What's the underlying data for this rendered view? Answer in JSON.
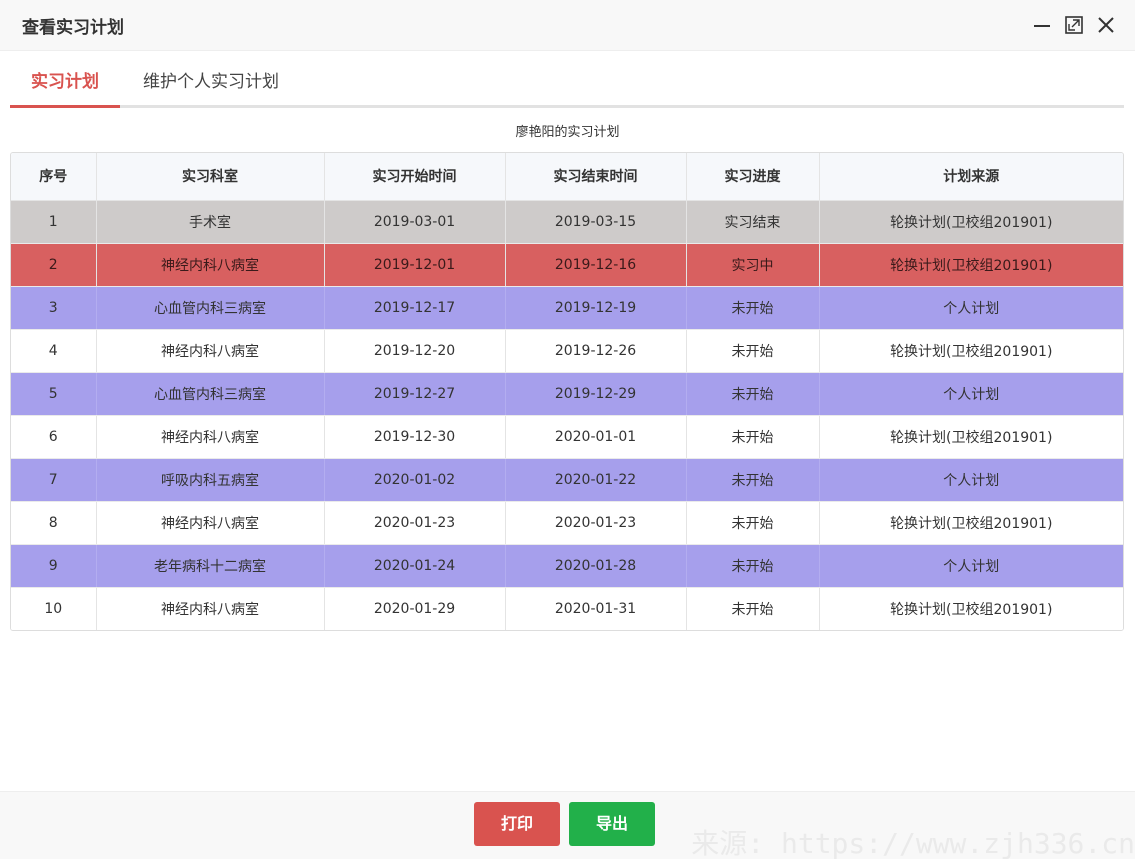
{
  "window": {
    "title": "查看实习计划",
    "controls": [
      "minimize-icon",
      "maximize-icon",
      "close-icon"
    ]
  },
  "tabs": [
    {
      "label": "实习计划",
      "active": true
    },
    {
      "label": "维护个人实习计划",
      "active": false
    }
  ],
  "table": {
    "caption": "廖艳阳的实习计划",
    "columns": [
      "序号",
      "实习科室",
      "实习开始时间",
      "实习结束时间",
      "实习进度",
      "计划来源"
    ],
    "rows": [
      {
        "no": "1",
        "dept": "手术室",
        "start": "2019-03-01",
        "end": "2019-03-15",
        "progress": "实习结束",
        "source": "轮换计划(卫校组201901)",
        "status": "done"
      },
      {
        "no": "2",
        "dept": "神经内科八病室",
        "start": "2019-12-01",
        "end": "2019-12-16",
        "progress": "实习中",
        "source": "轮换计划(卫校组201901)",
        "status": "doing"
      },
      {
        "no": "3",
        "dept": "心血管内科三病室",
        "start": "2019-12-17",
        "end": "2019-12-19",
        "progress": "未开始",
        "source": "个人计划",
        "status": "personal"
      },
      {
        "no": "4",
        "dept": "神经内科八病室",
        "start": "2019-12-20",
        "end": "2019-12-26",
        "progress": "未开始",
        "source": "轮换计划(卫校组201901)",
        "status": "normal"
      },
      {
        "no": "5",
        "dept": "心血管内科三病室",
        "start": "2019-12-27",
        "end": "2019-12-29",
        "progress": "未开始",
        "source": "个人计划",
        "status": "personal"
      },
      {
        "no": "6",
        "dept": "神经内科八病室",
        "start": "2019-12-30",
        "end": "2020-01-01",
        "progress": "未开始",
        "source": "轮换计划(卫校组201901)",
        "status": "normal"
      },
      {
        "no": "7",
        "dept": "呼吸内科五病室",
        "start": "2020-01-02",
        "end": "2020-01-22",
        "progress": "未开始",
        "source": "个人计划",
        "status": "personal"
      },
      {
        "no": "8",
        "dept": "神经内科八病室",
        "start": "2020-01-23",
        "end": "2020-01-23",
        "progress": "未开始",
        "source": "轮换计划(卫校组201901)",
        "status": "normal"
      },
      {
        "no": "9",
        "dept": "老年病科十二病室",
        "start": "2020-01-24",
        "end": "2020-01-28",
        "progress": "未开始",
        "source": "个人计划",
        "status": "personal"
      },
      {
        "no": "10",
        "dept": "神经内科八病室",
        "start": "2020-01-29",
        "end": "2020-01-31",
        "progress": "未开始",
        "source": "轮换计划(卫校组201901)",
        "status": "normal"
      }
    ]
  },
  "footer": {
    "print_label": "打印",
    "export_label": "导出"
  },
  "watermark": "来源: https://www.zjh336.cn",
  "colors": {
    "accent": "#d9534f",
    "export": "#22b04a",
    "row_done": "#cecbca",
    "row_doing": "#d86060",
    "row_personal": "#a69fec"
  }
}
